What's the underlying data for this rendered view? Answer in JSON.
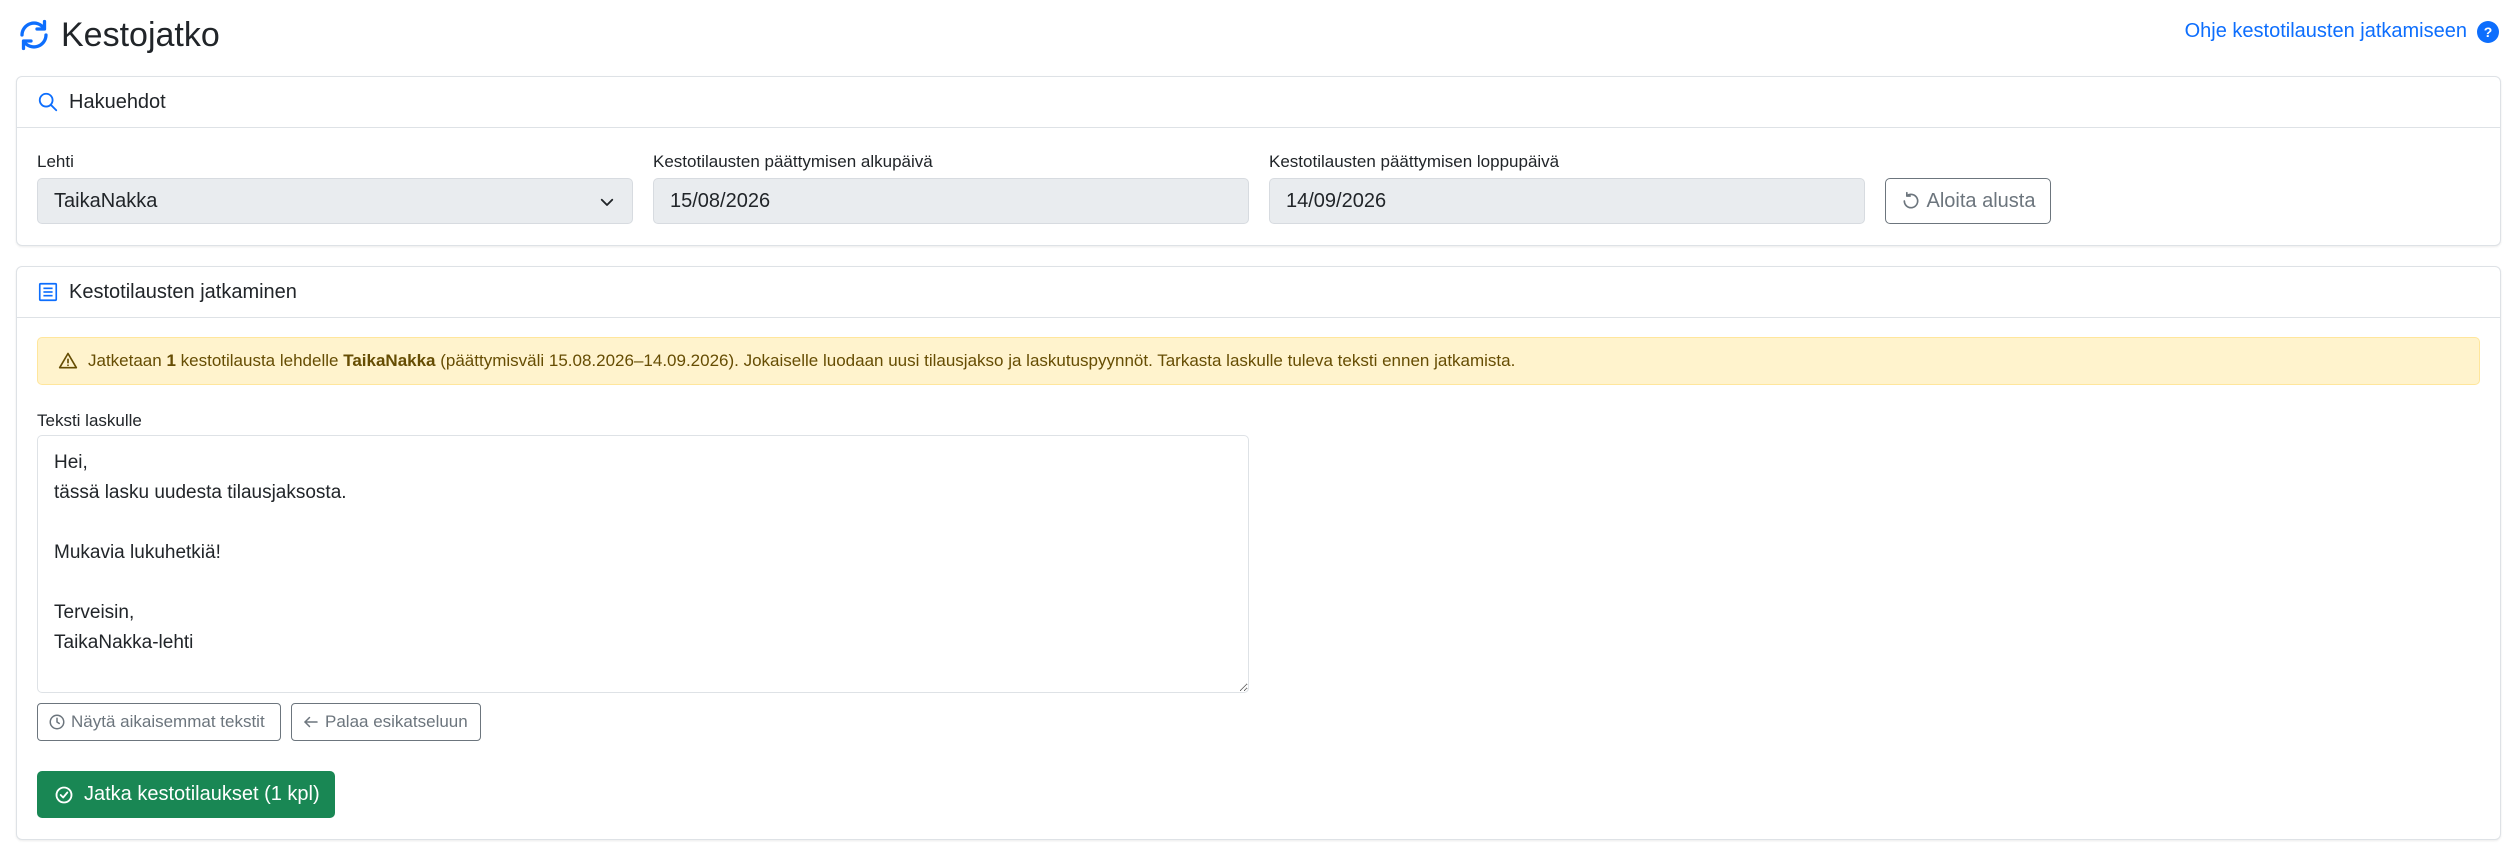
{
  "header": {
    "title": "Kestojatko",
    "title_icon": "refresh-icon",
    "help_link": "Ohje kestotilausten jatkamiseen",
    "help_icon": "question-circle-icon"
  },
  "search": {
    "title": "Hakuehdot",
    "icon": "search-icon",
    "paper_label": "Lehti",
    "paper_value": "TaikaNakka",
    "start_label": "Kestotilausten päättymisen alkupäivä",
    "start_value": "15/08/2026",
    "end_label": "Kestotilausten päättymisen loppupäivä",
    "end_value": "14/09/2026",
    "reset_label": "Aloita alusta"
  },
  "continuation": {
    "title": "Kestotilausten jatkaminen",
    "icon": "list-icon",
    "alert": {
      "icon": "warning-icon",
      "part1": "Jatketaan ",
      "count": "1",
      "part2": " kestotilausta lehdelle ",
      "paper": "TaikaNakka",
      "part3": " (päättymisväli 15.08.2026–14.09.2026). Jokaiselle luodaan uusi tilausjakso ja laskutuspyynnöt. Tarkasta laskulle tuleva teksti ennen jatkamista."
    },
    "textarea_label": "Teksti laskulle",
    "invoice_text": "Hei,\ntässä lasku uudesta tilausjaksosta.\n\nMukavia lukuhetkiä!\n\nTerveisin,\nTaikaNakka-lehti",
    "history_button": "Näytä aikaisemmat tekstit",
    "back_button": "Palaa esikatseluun",
    "submit_button": "Jatka kestotilaukset (1 kpl)"
  },
  "colors": {
    "primary": "#0d6efd",
    "success": "#198754",
    "warning_bg": "#fff3cd",
    "warning_text": "#664d03",
    "secondary": "#6c757d"
  }
}
